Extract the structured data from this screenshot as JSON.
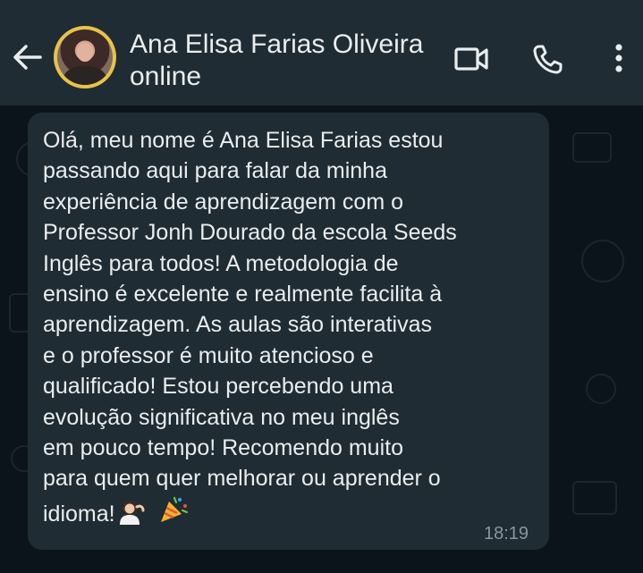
{
  "header": {
    "contact_name": "Ana Elisa Farias Oliveira",
    "contact_status": "online",
    "icons": {
      "back": "back-arrow-icon",
      "video": "video-camera-icon",
      "call": "phone-icon",
      "menu": "more-vertical-icon"
    }
  },
  "message": {
    "text": "Olá, meu nome é Ana Elisa Farias estou\npassando aqui para falar da minha\nexperiência de aprendizagem com o\nProfessor Jonh Dourado da escola Seeds\nInglês para todos! A metodologia de\nensino é excelente e realmente facilita à\naprendizagem. As aulas são interativas\ne o professor é muito atencioso e\nqualificado! Estou percebendo uma\nevolução significativa no meu inglês\nem pouco tempo! Recomendo muito\npara quem quer melhorar ou aprender o\nidioma!",
    "emojis": [
      "woman-tipping-hand-emoji",
      "party-popper-emoji"
    ],
    "time": "18:19"
  },
  "colors": {
    "header_bg": "#1f2c33",
    "chat_bg": "#0b141a",
    "bubble_bg": "#202c33",
    "text": "#e9edef",
    "muted": "#8696a0",
    "avatar_ring": "#e8c24a"
  }
}
